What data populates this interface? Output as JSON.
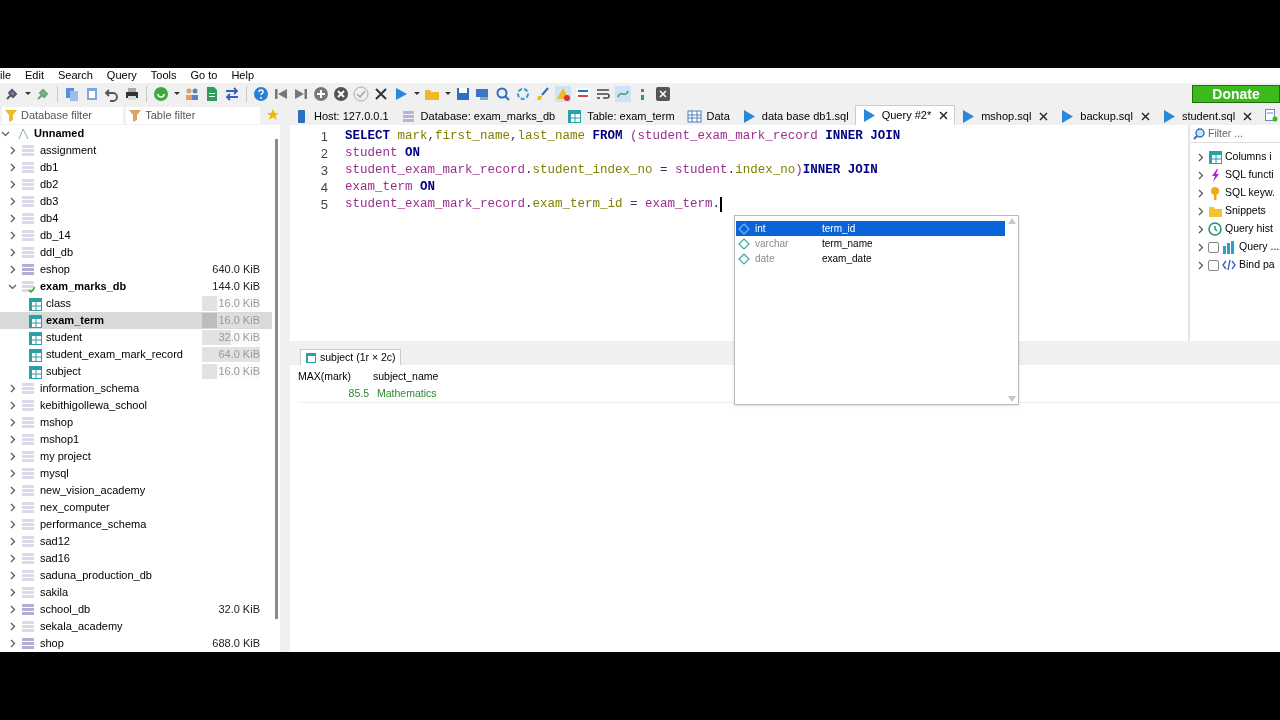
{
  "menu": [
    "ile",
    "Edit",
    "Search",
    "Query",
    "Tools",
    "Go to",
    "Help"
  ],
  "donate": "Donate",
  "filters": {
    "database": "Database filter",
    "table": "Table filter"
  },
  "tabs": [
    {
      "label": "Host: 127.0.0.1",
      "kind": "host",
      "selected": false,
      "closable": false
    },
    {
      "label": "Database: exam_marks_db",
      "kind": "database",
      "selected": false,
      "closable": false
    },
    {
      "label": "Table: exam_term",
      "kind": "table",
      "selected": false,
      "closable": false
    },
    {
      "label": "Data",
      "kind": "data",
      "selected": false,
      "closable": false
    },
    {
      "label": "data base db1.sql",
      "kind": "query",
      "selected": false,
      "closable": false
    },
    {
      "label": "Query #2*",
      "kind": "query",
      "selected": true,
      "closable": true
    },
    {
      "label": "mshop.sql",
      "kind": "query",
      "selected": false,
      "closable": true
    },
    {
      "label": "backup.sql",
      "kind": "query",
      "selected": false,
      "closable": true
    },
    {
      "label": "student.sql",
      "kind": "query",
      "selected": false,
      "closable": true
    }
  ],
  "tree": {
    "name": "Unnamed",
    "expanded": true,
    "children": [
      {
        "name": "assignment",
        "expanded": false
      },
      {
        "name": "db1",
        "expanded": false
      },
      {
        "name": "db2",
        "expanded": false
      },
      {
        "name": "db3",
        "expanded": false
      },
      {
        "name": "db4",
        "expanded": false
      },
      {
        "name": "db_14",
        "expanded": false
      },
      {
        "name": "ddl_db",
        "expanded": false
      },
      {
        "name": "eshop",
        "size": "640.0 KiB",
        "expanded": false
      },
      {
        "name": "exam_marks_db",
        "size": "144.0 KiB",
        "expanded": true,
        "children": [
          {
            "name": "class",
            "size": "16.0 KiB",
            "level": 0.25,
            "selected": false
          },
          {
            "name": "exam_term",
            "size": "16.0 KiB",
            "level": 0.25,
            "selected": true
          },
          {
            "name": "student",
            "size": "32.0 KiB",
            "level": 0.5,
            "selected": false
          },
          {
            "name": "student_exam_mark_record",
            "size": "64.0 KiB",
            "level": 1,
            "selected": false
          },
          {
            "name": "subject",
            "size": "16.0 KiB",
            "level": 0.25,
            "selected": false
          }
        ]
      },
      {
        "name": "information_schema",
        "expanded": false
      },
      {
        "name": "kebithigollewa_school",
        "expanded": false
      },
      {
        "name": "mshop",
        "expanded": false
      },
      {
        "name": "mshop1",
        "expanded": false
      },
      {
        "name": "my project",
        "expanded": false
      },
      {
        "name": "mysql",
        "expanded": false
      },
      {
        "name": "new_vision_academy",
        "expanded": false
      },
      {
        "name": "nex_computer",
        "expanded": false
      },
      {
        "name": "performance_schema",
        "expanded": false
      },
      {
        "name": "sad12",
        "expanded": false
      },
      {
        "name": "sad16",
        "expanded": false
      },
      {
        "name": "saduna_production_db",
        "expanded": false
      },
      {
        "name": "sakila",
        "expanded": false
      },
      {
        "name": "school_db",
        "size": "32.0 KiB",
        "expanded": false
      },
      {
        "name": "sekala_academy",
        "expanded": false
      },
      {
        "name": "shop",
        "size": "688.0 KiB",
        "expanded": false
      }
    ]
  },
  "editor": {
    "lines": [
      {
        "number": "1",
        "tokens": [
          {
            "t": "SELECT ",
            "kind": "keyword"
          },
          {
            "t": "mark",
            "kind": "column"
          },
          {
            "t": ",",
            "kind": "plain"
          },
          {
            "t": "first_name",
            "kind": "column"
          },
          {
            "t": ",",
            "kind": "plain"
          },
          {
            "t": "last_name ",
            "kind": "column"
          },
          {
            "t": "FROM ",
            "kind": "keyword"
          },
          {
            "t": "(student_exam_mark_record ",
            "kind": "table"
          },
          {
            "t": "INNER JOIN",
            "kind": "keyword"
          }
        ]
      },
      {
        "number": "2",
        "tokens": [
          {
            "t": "student ",
            "kind": "table"
          },
          {
            "t": "ON",
            "kind": "keyword"
          }
        ]
      },
      {
        "number": "3",
        "tokens": [
          {
            "t": "student_exam_mark_record",
            "kind": "table"
          },
          {
            "t": ".",
            "kind": "plain"
          },
          {
            "t": "student_index_no ",
            "kind": "column"
          },
          {
            "t": "= ",
            "kind": "plain"
          },
          {
            "t": "student",
            "kind": "table"
          },
          {
            "t": ".",
            "kind": "plain"
          },
          {
            "t": "index_no",
            "kind": "column"
          },
          {
            "t": ")",
            "kind": "table"
          },
          {
            "t": "INNER JOIN",
            "kind": "keyword"
          }
        ]
      },
      {
        "number": "4",
        "tokens": [
          {
            "t": "exam_term ",
            "kind": "table"
          },
          {
            "t": "ON",
            "kind": "keyword"
          }
        ]
      },
      {
        "number": "5",
        "tokens": [
          {
            "t": "student_exam_mark_record",
            "kind": "table"
          },
          {
            "t": ".",
            "kind": "plain"
          },
          {
            "t": "exam_term_id ",
            "kind": "column"
          },
          {
            "t": "= ",
            "kind": "plain"
          },
          {
            "t": "exam_term",
            "kind": "table"
          },
          {
            "t": ".",
            "kind": "plain"
          }
        ]
      }
    ]
  },
  "autocomplete": [
    {
      "type": "int",
      "name": "term_id",
      "selected": true
    },
    {
      "type": "varchar",
      "name": "term_name",
      "selected": false
    },
    {
      "type": "date",
      "name": "exam_date",
      "selected": false
    }
  ],
  "results": {
    "tab": "subject (1r × 2c)",
    "columns": [
      "MAX(mark)",
      "subject_name"
    ],
    "rows": [
      [
        "85.5",
        "Mathematics"
      ]
    ]
  },
  "helpers": {
    "filter_placeholder": "Filter ...",
    "items": [
      {
        "label": "Columns i",
        "kind": "columns"
      },
      {
        "label": "SQL functi",
        "kind": "functions"
      },
      {
        "label": "SQL keyw.",
        "kind": "keywords"
      },
      {
        "label": "Snippets",
        "kind": "snippets"
      },
      {
        "label": "Query hist",
        "kind": "history"
      },
      {
        "label": "Query ...",
        "kind": "profile",
        "checked": false
      },
      {
        "label": "Bind pa",
        "kind": "bind",
        "checked": false
      }
    ]
  }
}
